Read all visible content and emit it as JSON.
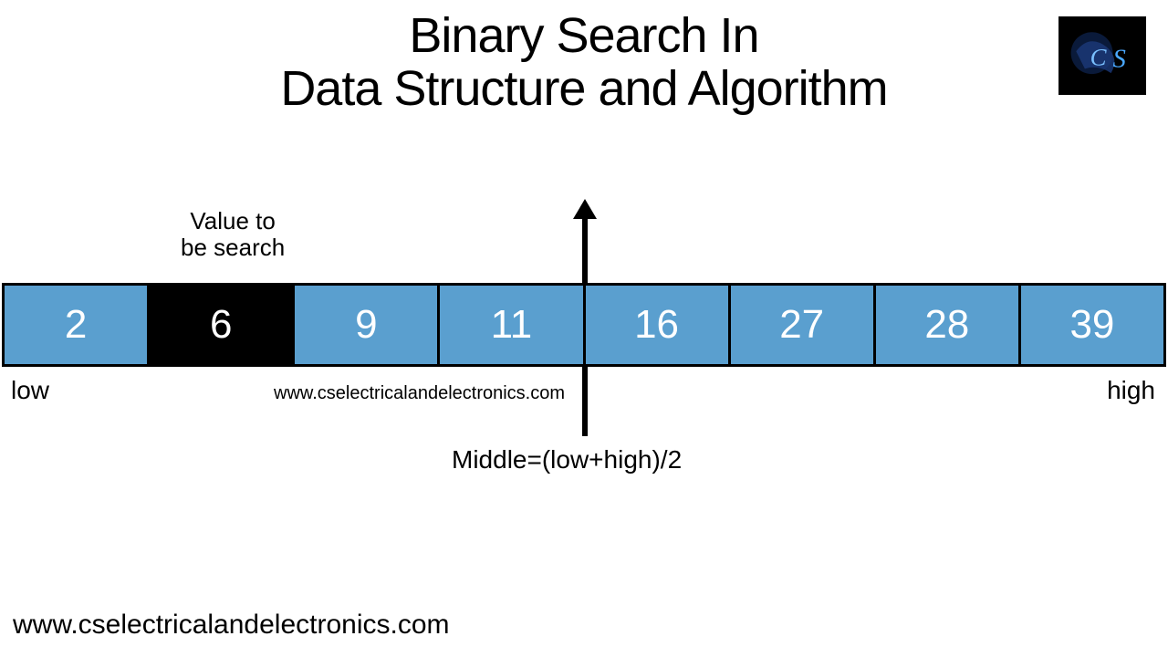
{
  "title": {
    "line1": "Binary Search In",
    "line2": "Data Structure and Algorithm"
  },
  "diagram": {
    "search_label_line1": "Value to",
    "search_label_line2": "be search",
    "low_label": "low",
    "high_label": "high",
    "middle_formula": "Middle=(low+high)/2",
    "watermark_mid": "www.cselectricalandelectronics.com",
    "array": [
      {
        "value": "2",
        "highlight": false
      },
      {
        "value": "6",
        "highlight": true
      },
      {
        "value": "9",
        "highlight": false
      },
      {
        "value": "11",
        "highlight": false
      },
      {
        "value": "16",
        "highlight": false
      },
      {
        "value": "27",
        "highlight": false
      },
      {
        "value": "28",
        "highlight": false
      },
      {
        "value": "39",
        "highlight": false
      }
    ]
  },
  "footer_url": "www.cselectricalandelectronics.com",
  "logo_text": "CS",
  "chart_data": {
    "type": "table",
    "title": "Binary Search In Data Structure and Algorithm",
    "array_values": [
      2,
      6,
      9,
      11,
      16,
      27,
      28,
      39
    ],
    "target_value": 6,
    "low_index": 0,
    "high_index": 7,
    "middle_formula": "Middle=(low+high)/2",
    "labels": {
      "low": "low",
      "high": "high",
      "target": "Value to be search"
    }
  }
}
